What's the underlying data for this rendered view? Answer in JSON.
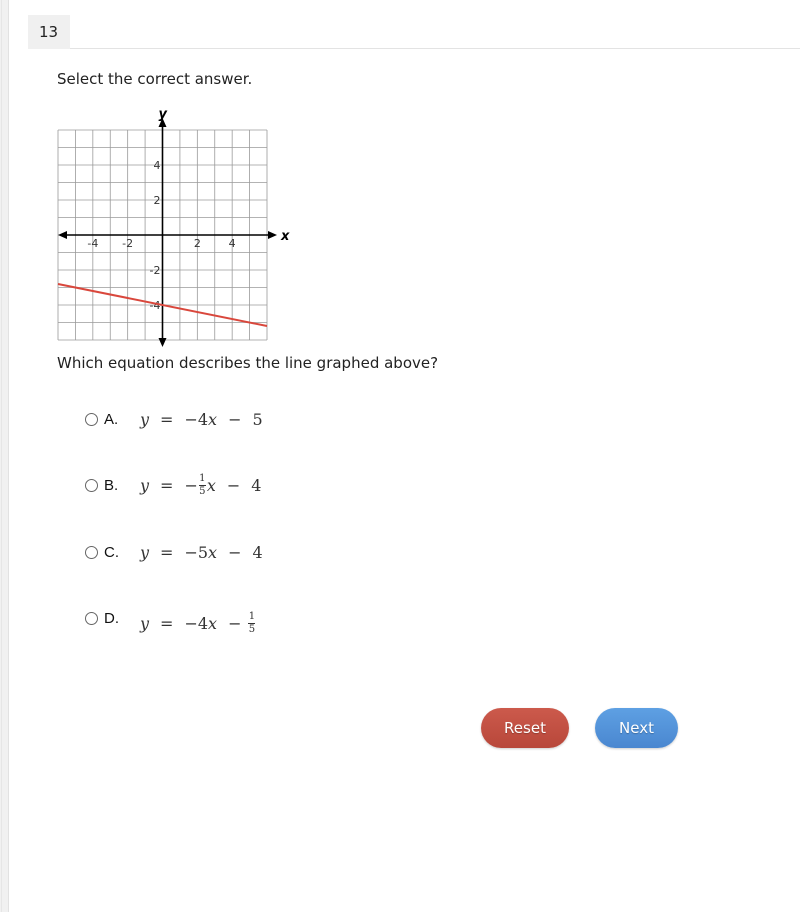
{
  "question_number": "13",
  "instruction": "Select the correct answer.",
  "question_text": "Which equation describes the line graphed above?",
  "options": [
    {
      "letter": "A.",
      "lhs": "y",
      "eq": "=",
      "parts": [
        "−4",
        "x",
        "−",
        "5"
      ],
      "label": "y = −4x − 5"
    },
    {
      "letter": "B.",
      "lhs": "y",
      "eq": "=",
      "frac_num": "1",
      "frac_den": "5",
      "label": "y = −(1/5)x − 4",
      "tail": "4"
    },
    {
      "letter": "C.",
      "lhs": "y",
      "eq": "=",
      "parts": [
        "−5",
        "x",
        "−",
        "4"
      ],
      "label": "y = −5x − 4"
    },
    {
      "letter": "D.",
      "lhs": "y",
      "eq": "=",
      "frac_num": "1",
      "frac_den": "5",
      "label": "y = −4x − 1/5",
      "coef": "−4"
    }
  ],
  "buttons": {
    "reset": "Reset",
    "next": "Next"
  },
  "colors": {
    "line": "#d9473c",
    "reset": "#c0503f",
    "next": "#5193da"
  },
  "chart_data": {
    "type": "line",
    "title": "",
    "xlabel": "x",
    "ylabel": "y",
    "xlim": [
      -6,
      6
    ],
    "ylim": [
      -6,
      6
    ],
    "grid": true,
    "grid_step": 1,
    "x_ticks": [
      -4,
      -2,
      2,
      4
    ],
    "x_tick_labels": [
      "-4",
      "-2",
      "2",
      "4"
    ],
    "y_ticks": [
      4,
      2,
      -2,
      -4
    ],
    "y_tick_labels": [
      "4",
      "2",
      "-2",
      "-4"
    ],
    "series": [
      {
        "name": "line",
        "slope": -0.2,
        "intercept": -4,
        "x": [
          -6,
          6
        ],
        "y": [
          -2.8,
          -5.2
        ]
      }
    ]
  }
}
